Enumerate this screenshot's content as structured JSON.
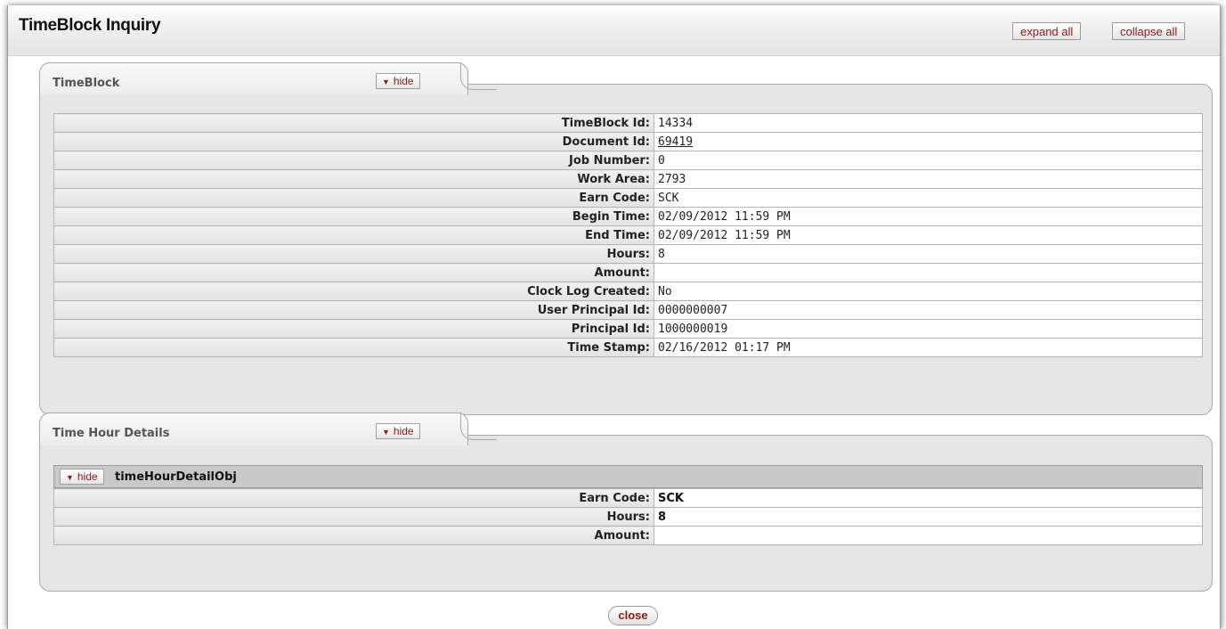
{
  "header": {
    "title": "TimeBlock Inquiry",
    "expand_all": "expand all",
    "collapse_all": "collapse all"
  },
  "timeblock": {
    "tab_title": "TimeBlock",
    "hide_label": "hide",
    "fields": [
      {
        "label": "TimeBlock Id:",
        "value": "14334"
      },
      {
        "label": "Document Id:",
        "value": "69419"
      },
      {
        "label": "Job Number:",
        "value": "0"
      },
      {
        "label": "Work Area:",
        "value": "2793"
      },
      {
        "label": "Earn Code:",
        "value": "SCK"
      },
      {
        "label": "Begin Time:",
        "value": "02/09/2012 11:59 PM"
      },
      {
        "label": "End Time:",
        "value": "02/09/2012 11:59 PM"
      },
      {
        "label": "Hours:",
        "value": "8"
      },
      {
        "label": "Amount:",
        "value": ""
      },
      {
        "label": "Clock Log Created:",
        "value": "No"
      },
      {
        "label": "User Principal Id:",
        "value": "0000000007"
      },
      {
        "label": "Principal Id:",
        "value": "1000000019"
      },
      {
        "label": "Time Stamp:",
        "value": "02/16/2012 01:17 PM"
      }
    ]
  },
  "time_hour_details": {
    "tab_title": "Time Hour Details",
    "hide_label": "hide",
    "object_title": "timeHourDetailObj",
    "object_hide_label": "hide",
    "fields": [
      {
        "label": "Earn Code:",
        "value": "SCK"
      },
      {
        "label": "Hours:",
        "value": "8"
      },
      {
        "label": "Amount:",
        "value": ""
      }
    ]
  },
  "footer": {
    "close_label": "close"
  },
  "colors": {
    "button_text": "#8c1a1a",
    "panel_bg": "#e6e6e6"
  }
}
